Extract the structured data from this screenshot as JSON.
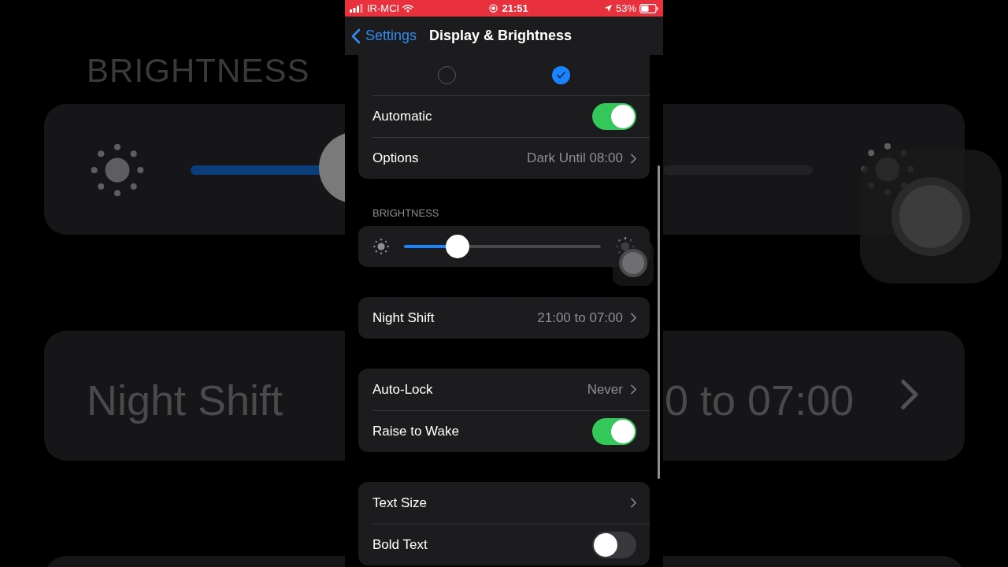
{
  "background": {
    "heading": "BRIGHTNESS",
    "row_label": "Night Shift",
    "row_value": "0 to 07:00"
  },
  "status_bar": {
    "carrier": "IR-MCI",
    "time": "21:51",
    "battery": "53%"
  },
  "nav": {
    "back": "Settings",
    "title": "Display & Brightness"
  },
  "sections": [
    {
      "rows": [
        {
          "kind": "radios",
          "options": [
            {
              "selected": false
            },
            {
              "selected": true
            }
          ]
        },
        {
          "kind": "toggle",
          "label": "Automatic",
          "on": true
        },
        {
          "kind": "link",
          "label": "Options",
          "value": "Dark Until 08:00"
        }
      ]
    },
    {
      "header": "BRIGHTNESS",
      "rows": [
        {
          "kind": "slider",
          "level": 0.27
        }
      ]
    },
    {
      "rows": [
        {
          "kind": "link",
          "label": "Night Shift",
          "value": "21:00 to 07:00"
        }
      ]
    },
    {
      "rows": [
        {
          "kind": "link",
          "label": "Auto-Lock",
          "value": "Never"
        },
        {
          "kind": "toggle",
          "label": "Raise to Wake",
          "on": true
        }
      ]
    },
    {
      "rows": [
        {
          "kind": "link",
          "label": "Text Size"
        },
        {
          "kind": "toggle",
          "label": "Bold Text",
          "on": false
        }
      ]
    }
  ]
}
